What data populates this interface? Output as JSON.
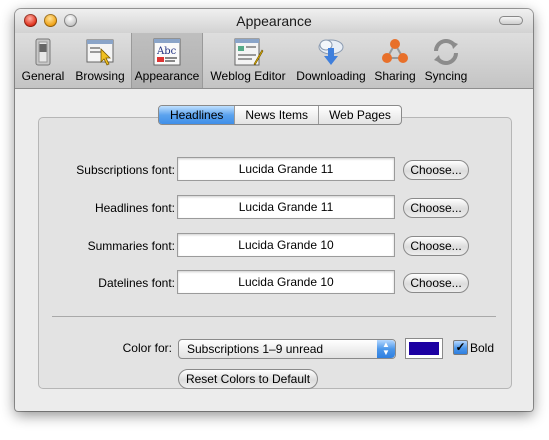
{
  "window": {
    "title": "Appearance"
  },
  "toolbar": {
    "items": [
      {
        "label": "General",
        "icon": "general-switch-icon"
      },
      {
        "label": "Browsing",
        "icon": "browsing-icon"
      },
      {
        "label": "Appearance",
        "icon": "appearance-icon",
        "selected": true
      },
      {
        "label": "Weblog Editor",
        "icon": "weblog-editor-icon"
      },
      {
        "label": "Downloading",
        "icon": "downloading-icon"
      },
      {
        "label": "Sharing",
        "icon": "sharing-icon"
      },
      {
        "label": "Syncing",
        "icon": "syncing-icon"
      }
    ]
  },
  "tabs": [
    "Headlines",
    "News Items",
    "Web Pages"
  ],
  "selected_tab": "Headlines",
  "fonts": [
    {
      "label": "Subscriptions font:",
      "value": "Lucida Grande 11",
      "button": "Choose..."
    },
    {
      "label": "Headlines font:",
      "value": "Lucida Grande 11",
      "button": "Choose..."
    },
    {
      "label": "Summaries font:",
      "value": "Lucida Grande 10",
      "button": "Choose..."
    },
    {
      "label": "Datelines font:",
      "value": "Lucida Grande 10",
      "button": "Choose..."
    }
  ],
  "color": {
    "label": "Color for:",
    "selected": "Subscriptions 1–9 unread",
    "swatch": "#1c00a2",
    "bold_label": "Bold",
    "bold_checked": true,
    "reset_label": "Reset Colors to Default"
  }
}
